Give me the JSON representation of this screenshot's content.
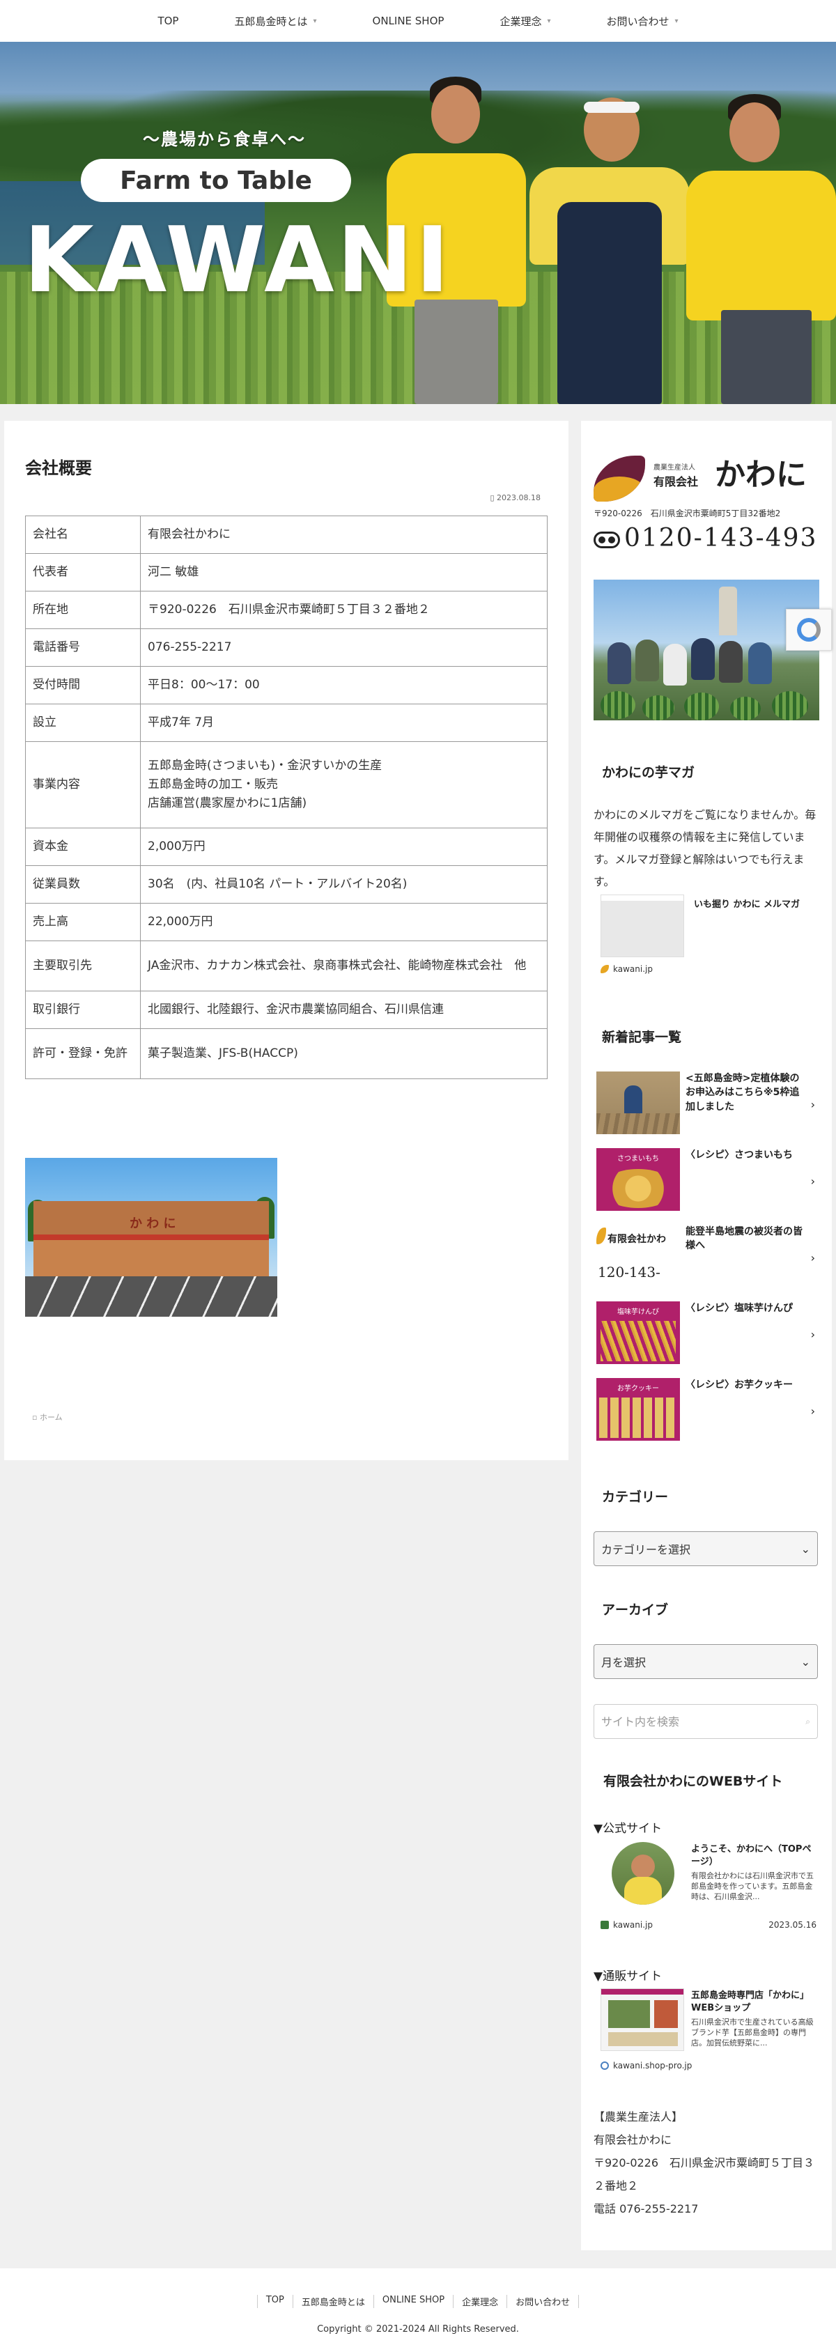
{
  "nav": {
    "items": [
      {
        "label": "TOP",
        "has_dropdown": false
      },
      {
        "label": "五郎島金時とは",
        "has_dropdown": true
      },
      {
        "label": "ONLINE SHOP",
        "has_dropdown": false
      },
      {
        "label": "企業理念",
        "has_dropdown": true
      },
      {
        "label": "お問い合わせ",
        "has_dropdown": true
      }
    ]
  },
  "hero": {
    "tagline": "〜農場から食卓へ〜",
    "pill": "Farm to Table",
    "brand": "KAWANI"
  },
  "page": {
    "title": "会社概要",
    "date": "2023.08.18",
    "table": [
      {
        "key": "会社名",
        "value": [
          "有限会社かわに"
        ]
      },
      {
        "key": "代表者",
        "value": [
          "河二 敏雄"
        ]
      },
      {
        "key": "所在地",
        "value": [
          "〒920-0226　石川県金沢市粟崎町５丁目３２番地２"
        ]
      },
      {
        "key": "電話番号",
        "value": [
          "076-255-2217"
        ]
      },
      {
        "key": "受付時間",
        "value": [
          "平日8：00〜17：00"
        ]
      },
      {
        "key": "設立",
        "value": [
          "平成7年 7月"
        ]
      },
      {
        "key": "事業内容",
        "value": [
          "五郎島金時(さつまいも)・金沢すいかの生産",
          "五郎島金時の加工・販売",
          "店舗運営(農家屋かわに1店舗)"
        ]
      },
      {
        "key": "資本金",
        "value": [
          "2,000万円"
        ]
      },
      {
        "key": "従業員数",
        "value": [
          "30名　(内、社員10名 パート・アルバイト20名)"
        ]
      },
      {
        "key": "売上高",
        "value": [
          "22,000万円"
        ]
      },
      {
        "key": "主要取引先",
        "value": [
          "JA金沢市、カナカン株式会社、泉商事株式会社、能崎物産株式会社　他"
        ]
      },
      {
        "key": "取引銀行",
        "value": [
          "北國銀行、北陸銀行、金沢市農業協同組合、石川県信連"
        ]
      },
      {
        "key": "許可・登録・免許",
        "value": [
          "菓子製造業、JFS-B(HACCP)"
        ]
      }
    ],
    "building_sign": "か わ に",
    "breadcrumb": "ホーム"
  },
  "sidebar": {
    "logo": {
      "corp_small": "農業生産法人",
      "corp": "有限会社",
      "name": "かわに",
      "address": "〒920-0226　石川県金沢市粟崎町5丁目32番地2",
      "tel": "0120-143-493"
    },
    "magazine": {
      "title": "かわにの芋マガ",
      "text": "かわにのメルマガをご覧になりませんか。毎年開催の収穫祭の情報を主に発信しています。メルマガ登録と解除はいつでも行えます。",
      "card_title": "いも掘り かわに メルマガ",
      "card_domain": "kawani.jp"
    },
    "recent": {
      "title": "新着記事一覧",
      "items": [
        {
          "title": "<五郎島金時>定植体験のお申込みはこちら※5枠追加しました",
          "thumb_text": ""
        },
        {
          "title": "〈レシピ〉さつまいもち",
          "thumb_text": "さつまいもち"
        },
        {
          "title": "能登半島地震の被災者の皆様へ",
          "thumb_text": "有限会社かわ"
        },
        {
          "title": "〈レシピ〉塩味芋けんぴ",
          "thumb_text": "塩味芋けんぴ"
        },
        {
          "title": "〈レシピ〉お芋クッキー",
          "thumb_text": "お芋クッキー"
        }
      ],
      "thumb3_tel": "120-143-"
    },
    "categories": {
      "title": "カテゴリー",
      "select": "カテゴリーを選択"
    },
    "archives": {
      "title": "アーカイブ",
      "select": "月を選択"
    },
    "search": {
      "placeholder": "サイト内を検索"
    },
    "websites": {
      "title": "有限会社かわにのWEBサイト",
      "official_label": "▼公式サイト",
      "official": {
        "title": "ようこそ、かわにへ（TOPページ）",
        "desc": "有限会社かわには石川県金沢市で五郎島金時を作っています。五郎島金時は、石川県金沢...",
        "domain": "kawani.jp",
        "date": "2023.05.16"
      },
      "shop_label": "▼通販サイト",
      "shop": {
        "title": "五郎島金時専門店「かわに」WEBショップ",
        "desc": "石川県金沢市で生産されている高級ブランド芋【五郎島金時】の専門店。加賀伝統野菜に...",
        "domain": "kawani.shop-pro.jp"
      }
    },
    "address_block": {
      "line1": "【農業生産法人】",
      "line2": "有限会社かわに",
      "line3": "〒920-0226　石川県金沢市粟崎町５丁目３２番地２",
      "line4": "電話 076-255-2217"
    }
  },
  "footer": {
    "nav": [
      "TOP",
      "五郎島金時とは",
      "ONLINE SHOP",
      "企業理念",
      "お問い合わせ"
    ],
    "copyright": "Copyright © 2021-2024 All Rights Reserved."
  },
  "colors": {
    "hero_shirt": "#f5d320",
    "logo_purple": "#6a1f3a",
    "logo_gold": "#e7a623",
    "recipe_magenta": "#b0206a"
  }
}
